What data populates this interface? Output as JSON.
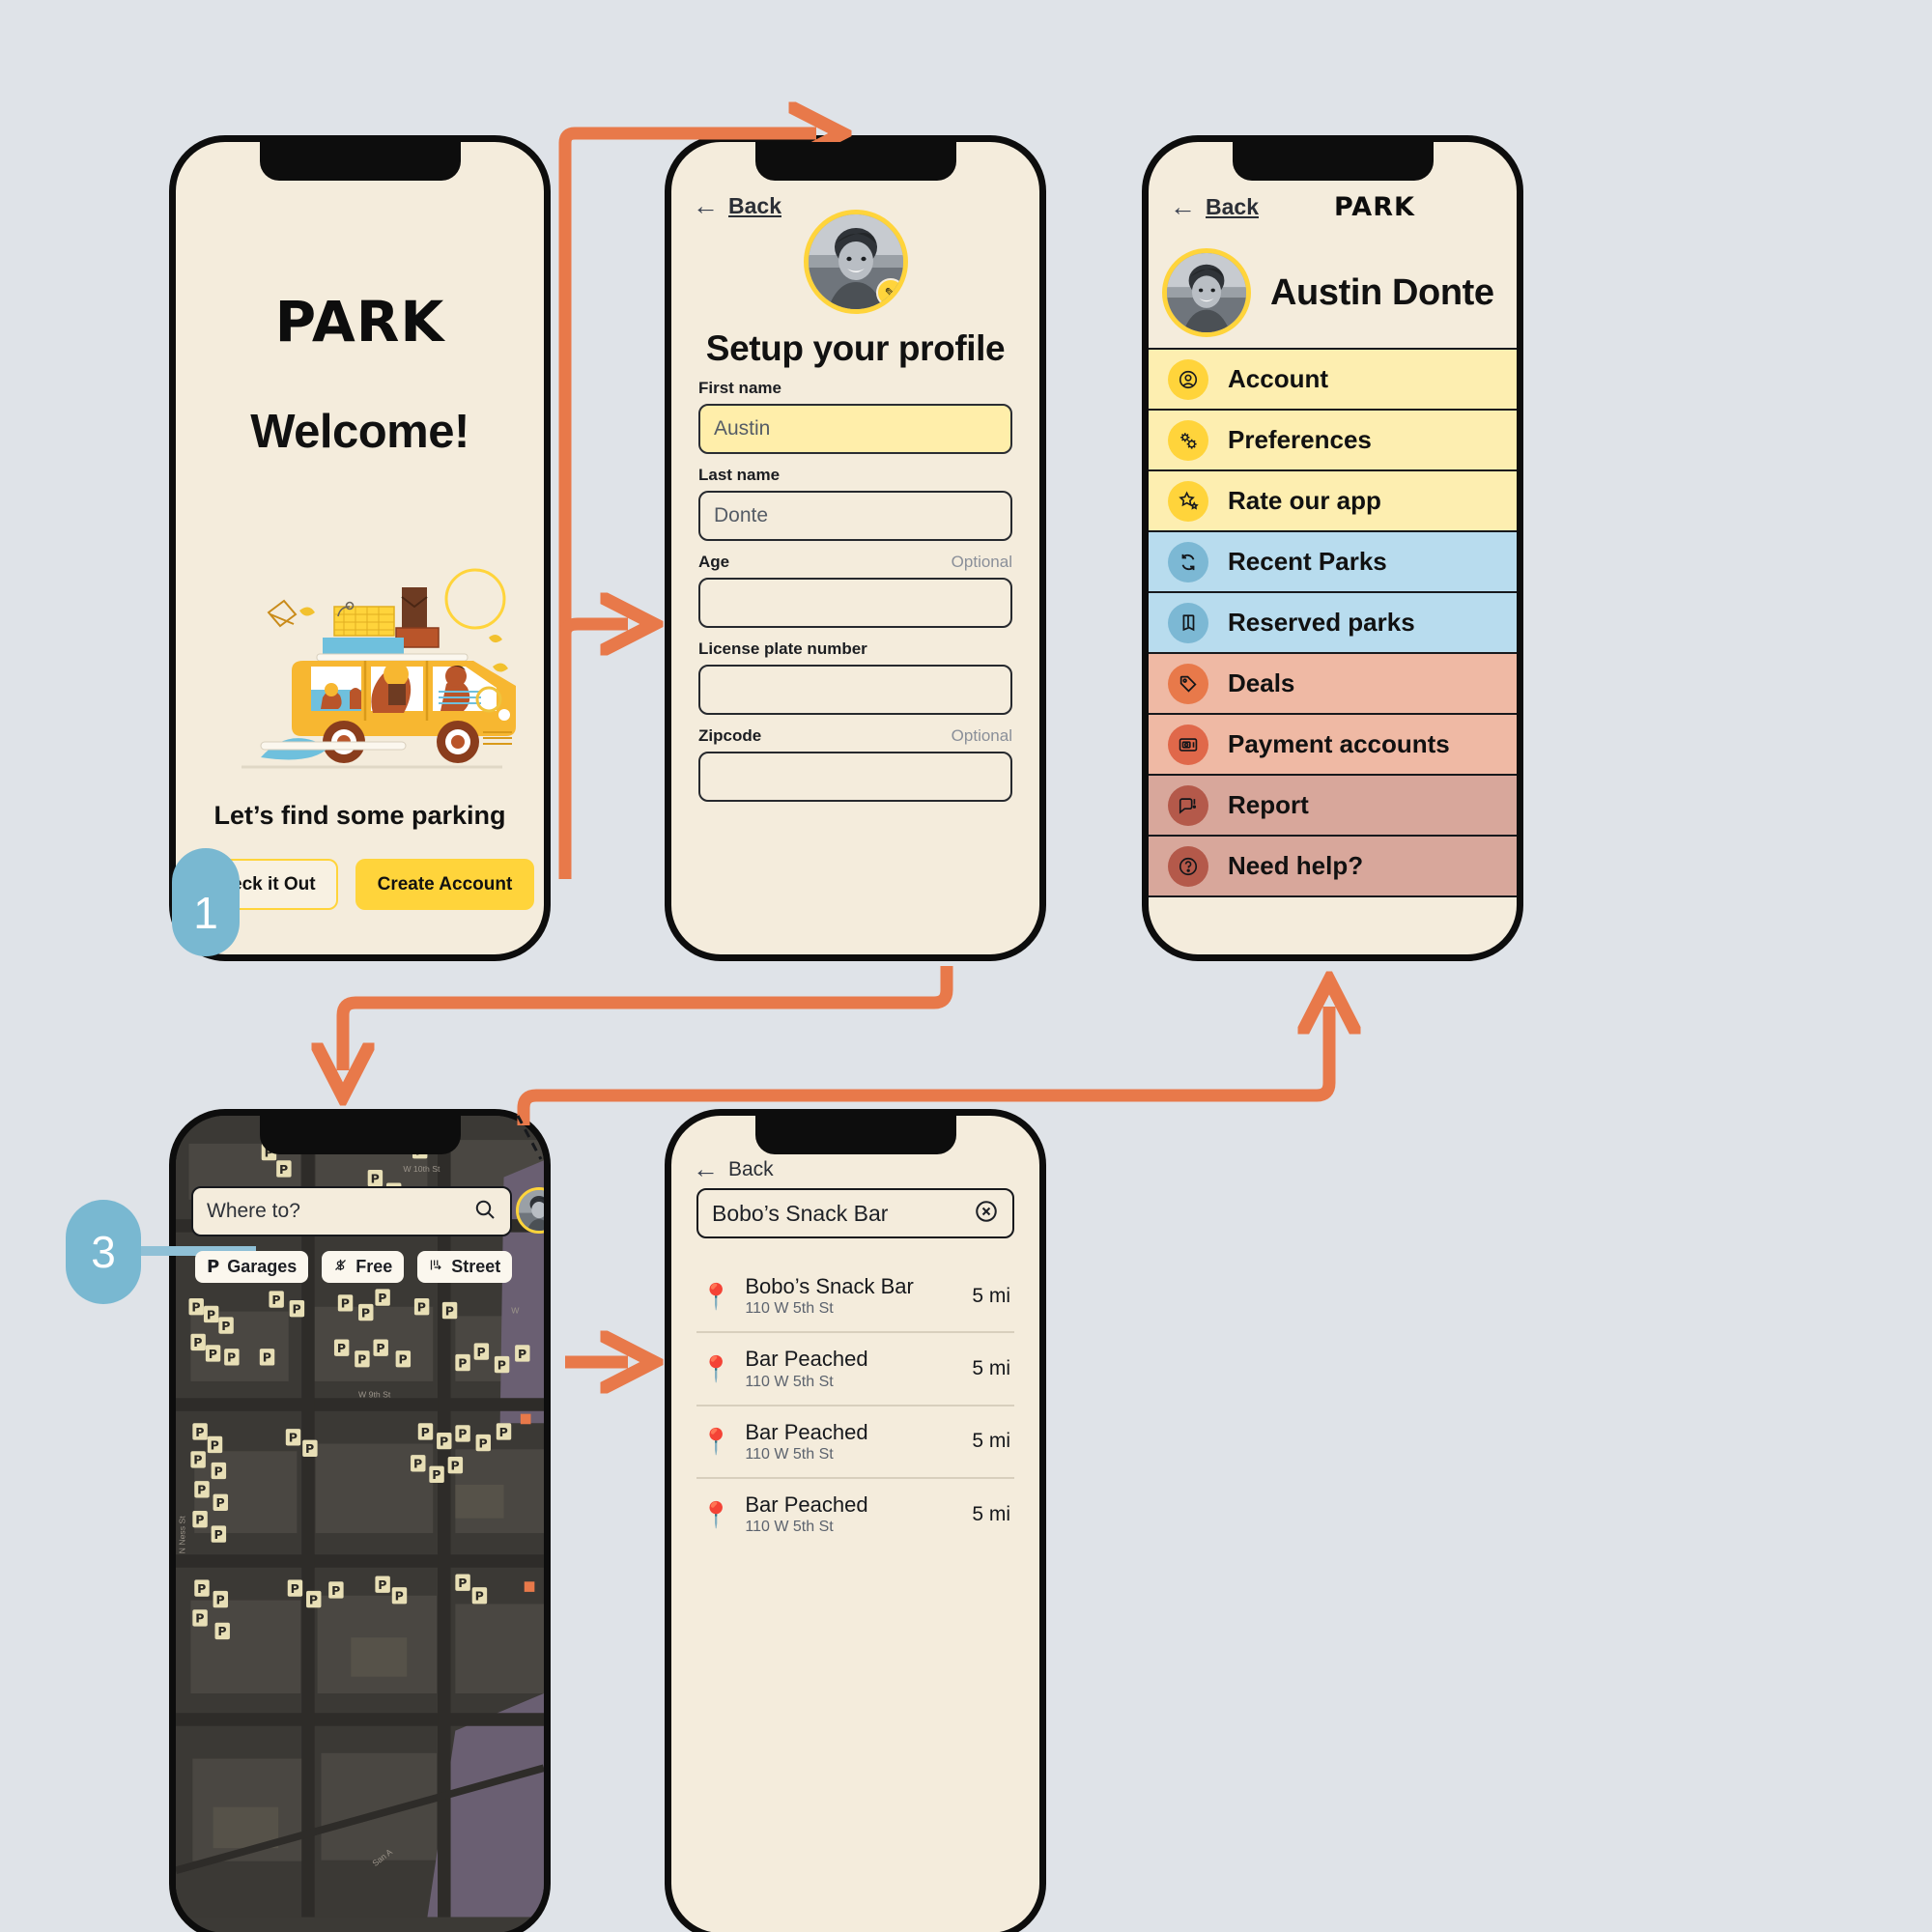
{
  "meta": {
    "brand": "PARK",
    "accent_yellow": "#ffd43b",
    "accent_orange": "#e8794a",
    "accent_blue": "#79b8d1",
    "canvas_bg": "#dfe3e8",
    "screen_bg": "#f4ecdc"
  },
  "screen1": {
    "logo": "PARK",
    "heading": "Welcome!",
    "tagline": "Let’s find some parking",
    "btn_secondary": "Check it Out",
    "btn_primary": "Create Account"
  },
  "screen2": {
    "back": "Back",
    "title": "Setup your profile",
    "edit_icon": "pencil-icon",
    "fields": [
      {
        "label": "First name",
        "optional": "",
        "value": "Austin",
        "filled": true
      },
      {
        "label": "Last name",
        "optional": "",
        "value": "Donte",
        "filled": false
      },
      {
        "label": "Age",
        "optional": "Optional",
        "value": "",
        "filled": false
      },
      {
        "label": "License plate number",
        "optional": "",
        "value": "",
        "filled": false
      },
      {
        "label": "Zipcode",
        "optional": "Optional",
        "value": "",
        "filled": false
      }
    ]
  },
  "screen3": {
    "back": "Back",
    "logo": "PARK",
    "name": "Austin Donte",
    "menu": [
      {
        "label": "Account",
        "icon": "account-icon",
        "row_bg": "#fdeeb0",
        "icon_bg": "#ffd43b"
      },
      {
        "label": "Preferences",
        "icon": "gears-icon",
        "row_bg": "#fdeeb0",
        "icon_bg": "#ffd43b"
      },
      {
        "label": "Rate our app",
        "icon": "star-icon",
        "row_bg": "#fdeeb0",
        "icon_bg": "#ffd43b"
      },
      {
        "label": "Recent Parks",
        "icon": "refresh-icon",
        "row_bg": "#b8dcee",
        "icon_bg": "#7cb8d4"
      },
      {
        "label": "Reserved parks",
        "icon": "book-icon",
        "row_bg": "#b8dcee",
        "icon_bg": "#7cb8d4"
      },
      {
        "label": "Deals",
        "icon": "tag-icon",
        "row_bg": "#efb9a4",
        "icon_bg": "#e8794a"
      },
      {
        "label": "Payment accounts",
        "icon": "wallet-icon",
        "row_bg": "#efb9a4",
        "icon_bg": "#e0684a"
      },
      {
        "label": "Report",
        "icon": "report-icon",
        "row_bg": "#d8a79b",
        "icon_bg": "#b4594a"
      },
      {
        "label": "Need help?",
        "icon": "question-icon",
        "row_bg": "#d8a79b",
        "icon_bg": "#b4594a"
      }
    ]
  },
  "screen4": {
    "search_placeholder": "Where to?",
    "search_icon": "search-icon",
    "chips": [
      {
        "label": "Garages",
        "icon": "p-icon"
      },
      {
        "label": "Free",
        "icon": "money-off-icon"
      },
      {
        "label": "Street",
        "icon": "parking-meter-icon"
      }
    ],
    "map_marker_letter": "P",
    "map_street_labels": [
      "W 10th St",
      "W 9th St",
      "N Ness St",
      "San A"
    ]
  },
  "screen5": {
    "back": "Back",
    "query": "Bobo’s Snack Bar",
    "clear_icon": "clear-circle-icon",
    "results": [
      {
        "name": "Bobo’s Snack Bar",
        "address": "110 W 5th St",
        "distance": "5 mi"
      },
      {
        "name": "Bar Peached",
        "address": "110 W 5th St",
        "distance": "5 mi"
      },
      {
        "name": "Bar Peached",
        "address": "110 W 5th St",
        "distance": "5 mi"
      },
      {
        "name": "Bar Peached",
        "address": "110 W 5th St",
        "distance": "5 mi"
      }
    ]
  },
  "steps": {
    "one": "1",
    "three": "3"
  }
}
